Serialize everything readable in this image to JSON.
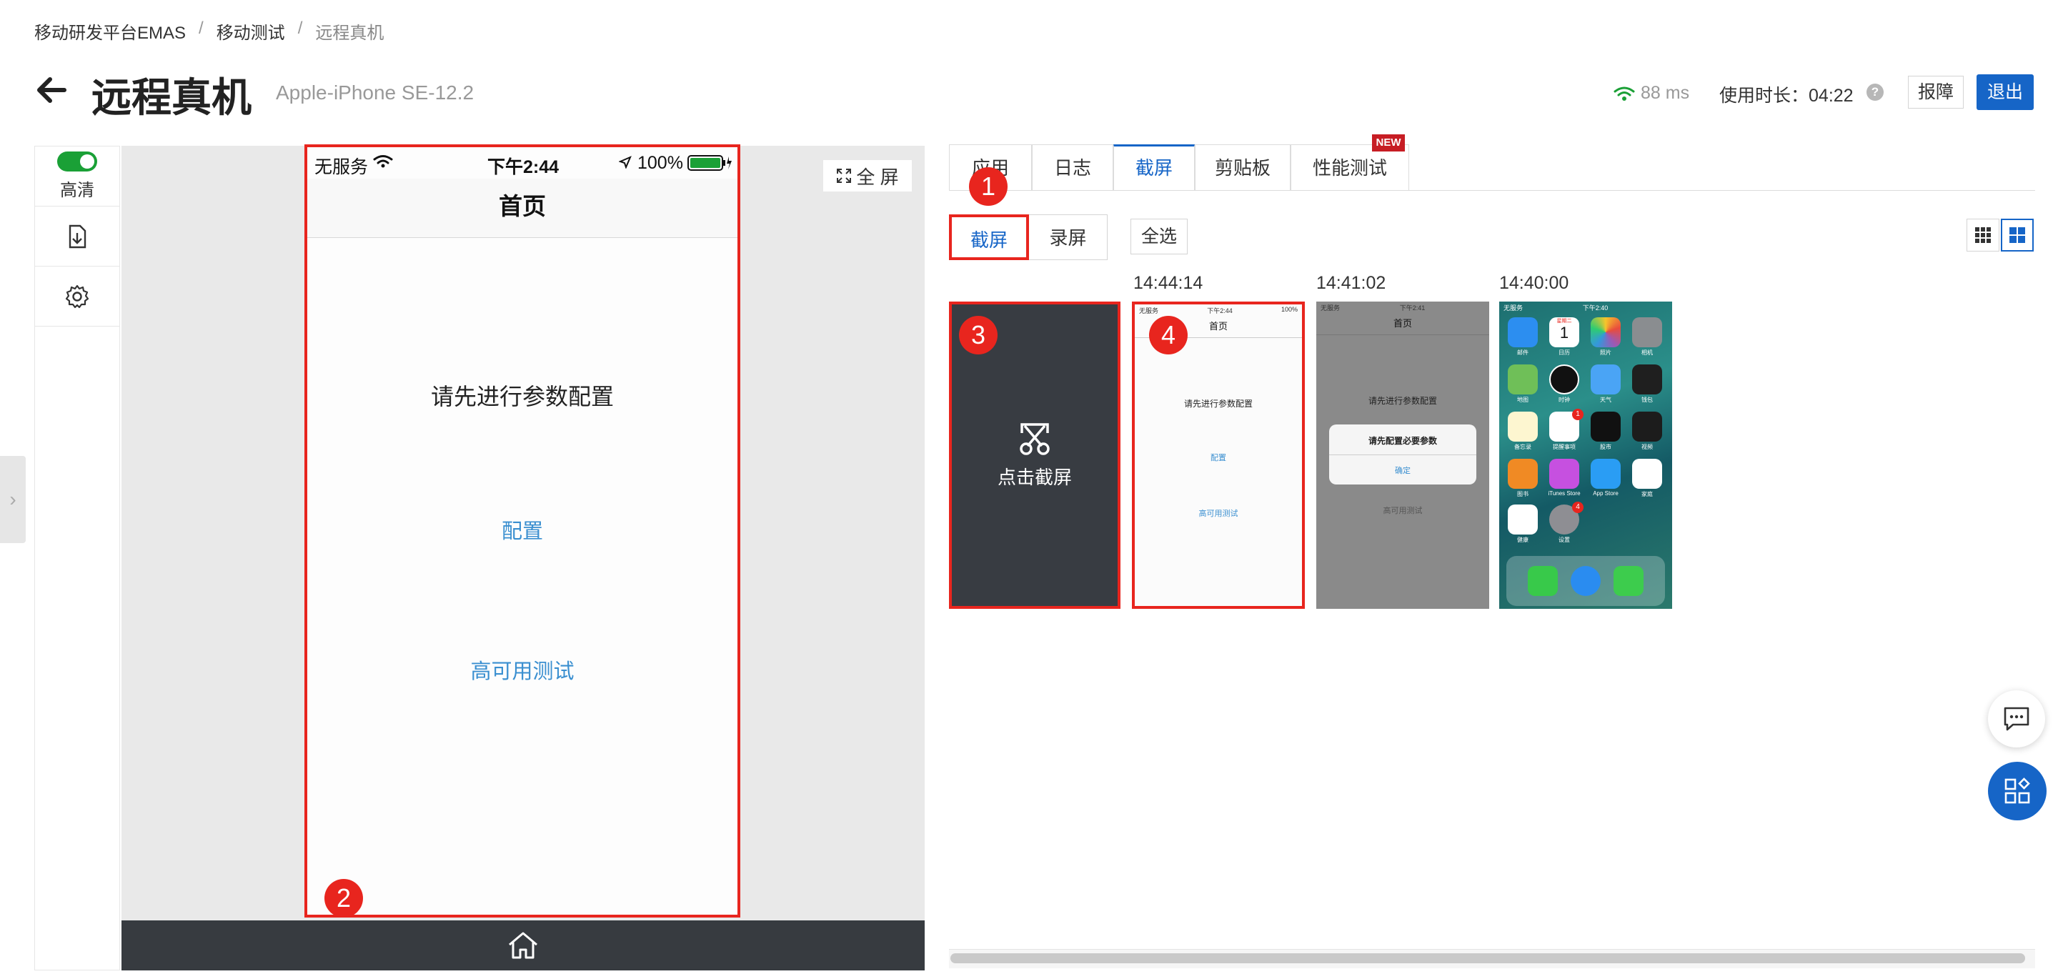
{
  "breadcrumb": {
    "items": [
      "移动研发平台EMAS",
      "移动测试",
      "远程真机"
    ],
    "sep": "/"
  },
  "header": {
    "title": "远程真机",
    "device": "Apple-iPhone SE-12.2"
  },
  "status": {
    "latency": "88 ms",
    "usage_label": "使用时长：",
    "usage_value": "04:22",
    "help": "?"
  },
  "actions": {
    "report": "报障",
    "exit": "退出"
  },
  "left_tools": {
    "hd_label": "高清",
    "hd_on": true
  },
  "side_handle": "›",
  "device": {
    "fullscreen_label": "全 屏",
    "status_bar": {
      "carrier": "无服务",
      "time": "下午2:44",
      "battery": "100%"
    },
    "nav_title": "首页",
    "message": "请先进行参数配置",
    "link_config": "配置",
    "link_ha": "高可用测试"
  },
  "tabs": [
    {
      "label": "应用",
      "active": false
    },
    {
      "label": "日志",
      "active": false
    },
    {
      "label": "截屏",
      "active": true
    },
    {
      "label": "剪贴板",
      "active": false
    },
    {
      "label": "性能测试",
      "active": false
    }
  ],
  "new_tag": "NEW",
  "subtabs": {
    "screenshot": "截屏",
    "record": "录屏"
  },
  "select_all": "全选",
  "capture": {
    "label": "点击截屏"
  },
  "screenshots": [
    {
      "time": "14:44:14",
      "status_left": "无服务",
      "status_time": "下午2:44",
      "status_right": "100%",
      "title": "首页",
      "message": "请先进行参数配置",
      "link1": "配置",
      "link2": "高可用测试"
    },
    {
      "time": "14:41:02",
      "status_left": "无服务",
      "status_time": "下午2:41",
      "title": "首页",
      "message": "请先进行参数配置",
      "dialog_text": "请先配置必要参数",
      "dialog_ok": "确定",
      "link2": "高可用测试"
    },
    {
      "time": "14:40:00",
      "status_left": "无服务",
      "status_time": "下午2:40",
      "calendar_day": "1",
      "calendar_weekday": "星期二",
      "apps": [
        "邮件",
        "日历",
        "照片",
        "相机",
        "地图",
        "时钟",
        "天气",
        "钱包",
        "备忘录",
        "提醒事项",
        "股市",
        "视频",
        "图书",
        "iTunes Store",
        "App Store",
        "家庭",
        "健康",
        "设置"
      ],
      "badges": {
        "reminders": "1",
        "settings": "4"
      }
    }
  ],
  "annotations": [
    "1",
    "2",
    "3",
    "4"
  ],
  "colors": {
    "accent": "#1665c7",
    "highlight": "#e8251e",
    "toggle": "#1aa036"
  }
}
